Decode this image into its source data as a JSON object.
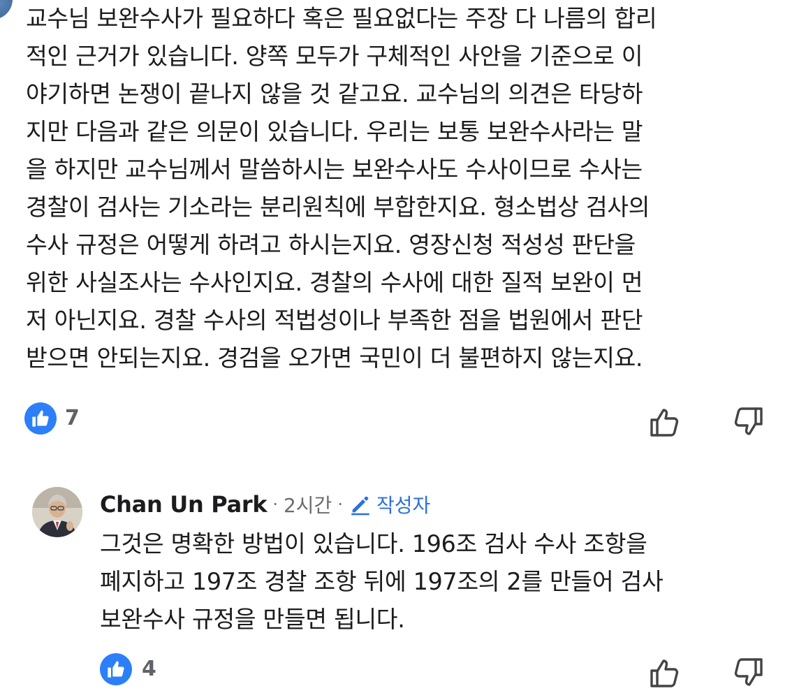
{
  "comment": {
    "body": "교수님 보완수사가 필요하다 혹은 필요없다는 주장 다 나름의 합리\n적인 근거가 있습니다. 양쪽 모두가 구체적인 사안을 기준으로 이\n야기하면 논쟁이 끝나지 않을 것 같고요. 교수님의 의견은 타당하\n지만 다음과 같은 의문이 있습니다. 우리는 보통 보완수사라는 말\n을 하지만 교수님께서 말씀하시는 보완수사도 수사이므로 수사는\n경찰이 검사는 기소라는 분리원칙에 부합한지요. 형소법상 검사의\n수사 규정은 어떻게 하려고 하시는지요. 영장신청 적성성 판단을\n위한 사실조사는 수사인지요. 경찰의 수사에 대한 질적 보완이 먼\n저 아닌지요. 경찰 수사의 적법성이나 부족한 점을 법원에서 판단\n받으면 안되는지요. 경검을 오가면 국민이 더 불편하지 않는지요.",
    "like_count": "7",
    "like_icon": "thumbs-up-icon",
    "dislike_icon": "thumbs-down-icon"
  },
  "reply": {
    "author": "Chan Un Park",
    "separator": "·",
    "time": "2시간",
    "author_badge": "작성자",
    "body": "그것은 명확한 방법이 있습니다. 196조 검사 수사 조항을\n폐지하고 197조 경찰 조항 뒤에 197조의 2를 만들어 검사\n보완수사 규정을 만들면 됩니다.",
    "like_count": "4"
  },
  "colors": {
    "like_badge": "#2d7ff9",
    "author_badge": "#2d6fdb",
    "meta_text": "#6b6b70"
  }
}
